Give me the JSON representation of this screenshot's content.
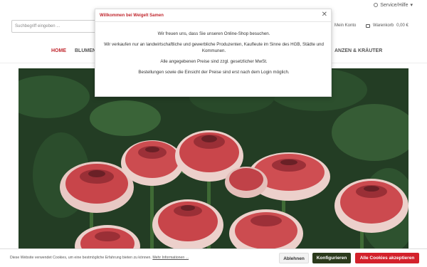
{
  "header": {
    "service_label": "Service/Hilfe",
    "search_placeholder": "Suchbegriff eingeben ...",
    "account_label": "Mein Konto",
    "cart_label": "Warenkorb",
    "cart_total": "0,00 €"
  },
  "nav": {
    "items": [
      {
        "label": "HOME"
      },
      {
        "label": "BLUMEN"
      },
      {
        "label": "ANZEN & KRÄUTER"
      }
    ]
  },
  "modal": {
    "title": "Willkommen bei Weigelt Samen",
    "close_icon": "close-icon",
    "paragraphs": [
      "Wir freuen uns, dass Sie unseren Online-Shop besuchen.",
      "Wir verkaufen nur an landwirtschaftliche und gewerbliche Produzenten, Kaufleute im Sinne des HGB, Städte und Kommunen.",
      "Alle angegebenen Preise sind zzgl. gesetzlicher MwSt.",
      "Bestellungen sowie die Einsicht der Preise sind erst nach dem Login möglich."
    ]
  },
  "cookie": {
    "text": "Diese Website verwendet Cookies, um eine bestmögliche Erfahrung bieten zu können.",
    "link": "Mehr Informationen ...",
    "reject": "Ablehnen",
    "configure": "Konfigurieren",
    "accept_all": "Alle Cookies akzeptieren"
  },
  "colors": {
    "brand_red": "#c0262d",
    "accept_red": "#d3212b",
    "configure_green": "#2b3a1c"
  }
}
